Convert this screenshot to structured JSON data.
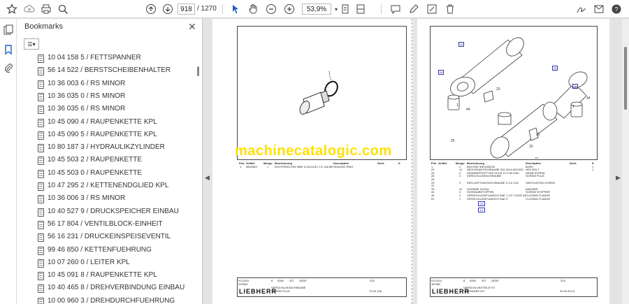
{
  "toolbar": {
    "current_page": "918",
    "total_pages": "/ 1270",
    "zoom": "53,9%"
  },
  "bookmarks": {
    "title": "Bookmarks",
    "items": [
      "10 04 158 5 / FETTSPANNER",
      "56 14 522 / BERSTSCHEIBENHALTER",
      "10 36 003 6 / RS MINOR",
      "10 36 035 0 / RS MINOR",
      "10 36 035 6 / RS MINOR",
      "10 45 090 4 / RAUPENKETTE KPL",
      "10 45 090 5 / RAUPENKETTE KPL",
      "10 80 187 3 / HYDRAULIKZYLINDER",
      "10 45 503 2 / RAUPENKETTE",
      "10 45 503 0 / RAUPENKETTE",
      "10 47 295 2 / KETTENENDGLIED KPL",
      "10 36 006 3 / RS MINOR",
      "10 40 527 9 / DRUCKSPEICHER EINBAU",
      "56 17 804 / VENTILBLOCK-EINHEIT",
      "56 16 231 / DRUCKEINSPEISEVENTIL",
      "99 46 850 / KETTENFUEHRUNG",
      "10 07 260 0 / LEITER KPL",
      "10 45 091 8 / RAUPENKETTE KPL",
      "10 40 465 8 / DREHVERBINDUNG EINBAU",
      "10 00 960 3 / DREHDURCHFUEHRUNG"
    ]
  },
  "watermark": "machinecatalogic.com",
  "left_page": {
    "columns": [
      "Pos.",
      "Artikel",
      "Menge",
      "Bezeichnung",
      "Description",
      "Serie",
      "K"
    ],
    "rows": [
      [
        "1",
        "5602563",
        "1",
        "DICHTRING DIN 3869 11,6X16,5X 1,5 -N4-NB",
        "SEALING RING",
        "",
        ""
      ]
    ],
    "part_label": "1",
    "footer": {
      "date": "9.6.2011",
      "num": "229394",
      "code1": "8",
      "code2": "5260",
      "code3": "437",
      "code4": "28267",
      "page": "315",
      "title_de": "VERSCHLUSSSCHRAUBE",
      "title_en": "SCREW PLUG",
      "ref": "73 63 128",
      "logo": "LIEBHERR"
    }
  },
  "right_page": {
    "columns": [
      "Pos.",
      "Artikel",
      "Menge",
      "Bezeichnung",
      "Description",
      "Serie",
      "K"
    ],
    "rows": [
      [
        "1",
        "",
        "2",
        "BUCHSE 3/50X35X28",
        "BUSH",
        "",
        "1"
      ],
      [
        "20",
        "",
        "11",
        "SECHSKANTSCHRAUBE ISO 4014 M10X30",
        "HEX BOLT",
        "",
        "1"
      ],
      [
        "25",
        "",
        "2",
        "GEWINDESTIFT DIN 913 M 12 X 60 4/64",
        "GRUB SCREW",
        "",
        ""
      ],
      [
        "26",
        "",
        "2",
        "VERSCHLUSSSCHRAUBE",
        "SCREW PLUG",
        "",
        ""
      ],
      [
        "28",
        "",
        "",
        "",
        "",
        "",
        ""
      ],
      [
        "29",
        "",
        "2",
        "ENTLUEFTUNGSSCHRAUBE G 1/4 X15",
        "VENTILATION SCREW",
        "",
        ""
      ],
      [
        "31",
        "",
        "",
        "",
        "",
        "",
        ""
      ],
      [
        "33",
        "",
        "11",
        "SCHEIBE 31X3/4",
        "WASHER",
        "",
        ""
      ],
      [
        "44",
        "",
        "2",
        "SCHRAUBSTOPFEN",
        "SCREW STOPPER",
        "",
        ""
      ],
      [
        "46",
        "",
        "1",
        "VERSCHLUSSFLANSCH SAE 1 1/2\" CODE 62",
        "CLOSING FLANGE",
        "",
        ""
      ],
      [
        "51",
        "",
        "1",
        "VERSCHLUSSFLANSCH SAE 2\"",
        "CLOSING FLANGE",
        "",
        ""
      ]
    ],
    "callouts": [
      "26",
      "28",
      "28",
      "26",
      "1",
      "44",
      "20",
      "1",
      "33",
      "46",
      "25",
      "29",
      "51"
    ],
    "footer": {
      "date": "9.6.2011",
      "num": "167462",
      "code1": "8",
      "code2": "5260",
      "code3": "437",
      "code4": "28267",
      "page": "315",
      "title_de": "VERSCHLUSSTEILE KIT",
      "title_en": "HARDWARE KIT",
      "ref": "94 63 913 5",
      "logo": "LIEBHERR"
    }
  }
}
